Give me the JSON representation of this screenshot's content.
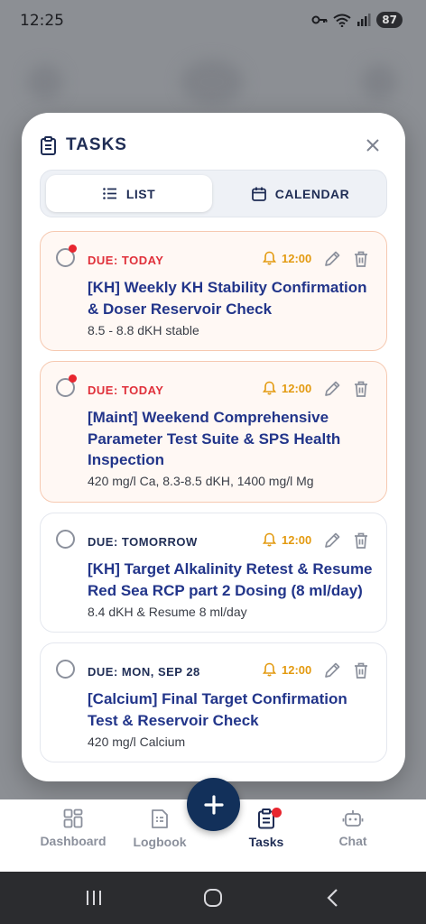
{
  "status_bar": {
    "time": "12:25",
    "battery": "87"
  },
  "modal": {
    "title": "TASKS",
    "tabs": [
      {
        "label": "LIST",
        "active": true
      },
      {
        "label": "CALENDAR",
        "active": false
      }
    ],
    "tasks": [
      {
        "due": "DUE: TODAY",
        "time": "12:00",
        "title": "[KH] Weekly KH Stability Confirmation & Doser Reservoir Check",
        "subtitle": "8.5 - 8.8 dKH stable",
        "overdue": true
      },
      {
        "due": "DUE: TODAY",
        "time": "12:00",
        "title": "[Maint] Weekend Comprehensive Parameter Test Suite & SPS Health Inspection",
        "subtitle": "420 mg/l Ca, 8.3-8.5 dKH, 1400 mg/l Mg",
        "overdue": true
      },
      {
        "due": "DUE: TOMORROW",
        "time": "12:00",
        "title": "[KH] Target Alkalinity Retest & Resume Red Sea RCP part 2 Dosing (8 ml/day)",
        "subtitle": "8.4 dKH & Resume 8 ml/day",
        "overdue": false
      },
      {
        "due": "DUE: MON, SEP 28",
        "time": "12:00",
        "title": "[Calcium] Final Target Confirmation Test & Reservoir Check",
        "subtitle": "420 mg/l Calcium",
        "overdue": false
      }
    ]
  },
  "bottom_nav": {
    "items": [
      {
        "label": "Dashboard",
        "icon": "dashboard-icon"
      },
      {
        "label": "Logbook",
        "icon": "logbook-icon"
      },
      {
        "label": "Tasks",
        "icon": "tasks-icon",
        "active": true
      },
      {
        "label": "Chat",
        "icon": "robot-icon"
      }
    ],
    "fab_icon": "plus-icon"
  },
  "colors": {
    "primary": "#1f2d55",
    "task_title": "#22358a",
    "due_today": "#e0303a",
    "time": "#e39a10",
    "fab": "#12305a"
  }
}
